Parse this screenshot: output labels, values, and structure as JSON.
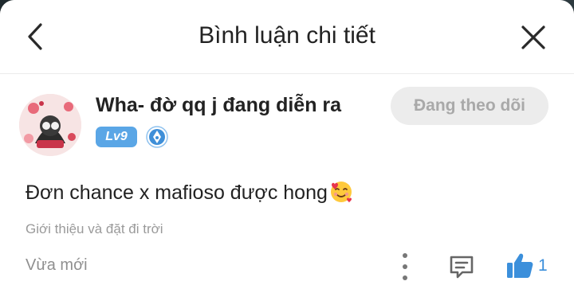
{
  "header": {
    "title": "Bình luận chi tiết",
    "back_icon": "chevron-left-icon",
    "close_icon": "close-icon"
  },
  "user": {
    "name": "Wha- đờ qq j đang diễn ra",
    "level": "Lv9",
    "follow_label": "Đang theo dõi",
    "badge_icon": "pen-badge-icon"
  },
  "comment": {
    "text": "Đơn chance x mafioso được hong",
    "emoji_icon": "smiling-face-with-hearts-icon",
    "subtitle": "Giới thiệu và đặt đi trời",
    "time": "Vừa mới",
    "like_count": "1"
  },
  "colors": {
    "accent": "#3b8fdb",
    "level_badge": "#5aa6e6",
    "follow_bg": "#ececec",
    "follow_text": "#a9a9a9"
  }
}
